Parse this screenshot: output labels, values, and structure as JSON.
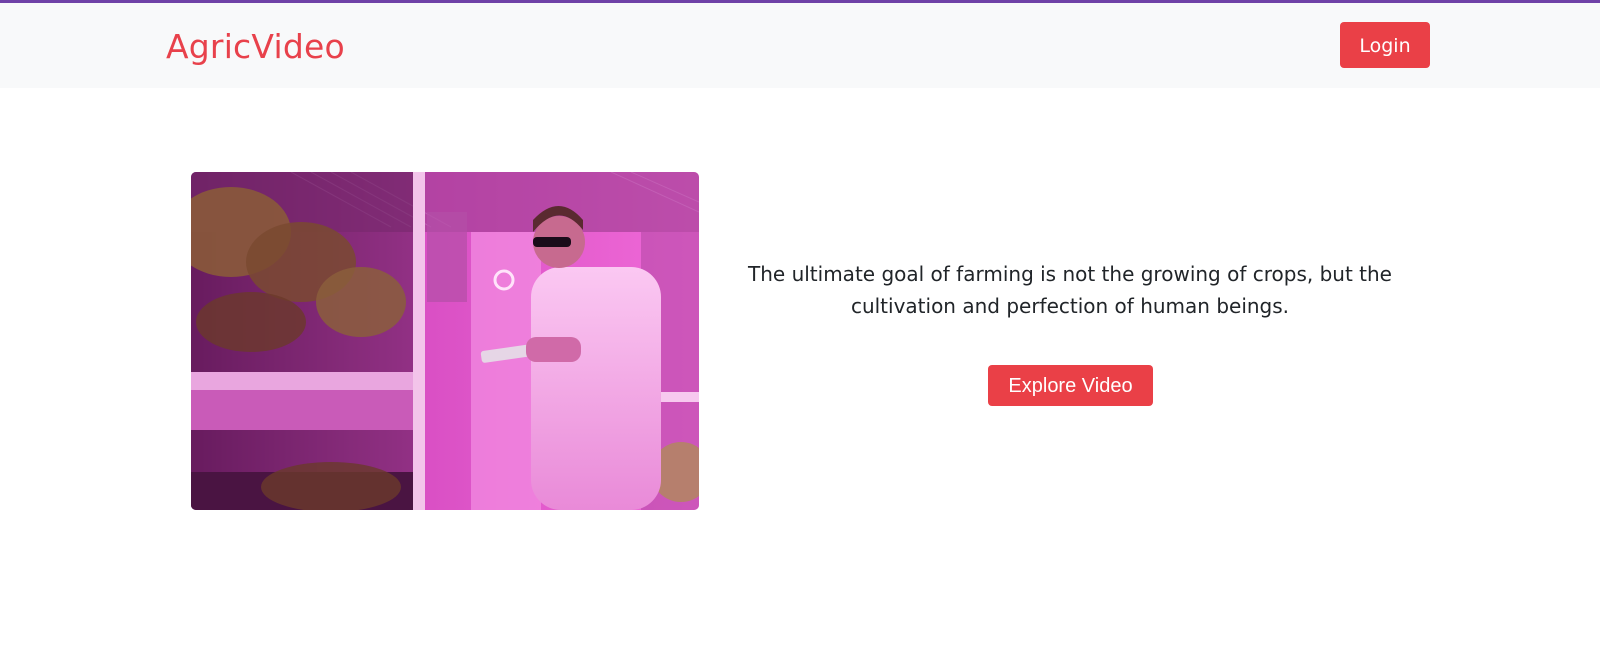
{
  "header": {
    "brand": "AgricVideo",
    "login_label": "Login"
  },
  "hero": {
    "image_icon": "farmer-in-grow-room-photo",
    "quote": "The ultimate goal of farming is not the growing of crops, but the cultivation and perfection of human beings.",
    "cta_label": "Explore Video"
  },
  "colors": {
    "accent": "#ea4047",
    "brand": "#e8414b",
    "top_bar": "#6f42a7",
    "navbar_bg": "#f8f9fa"
  }
}
